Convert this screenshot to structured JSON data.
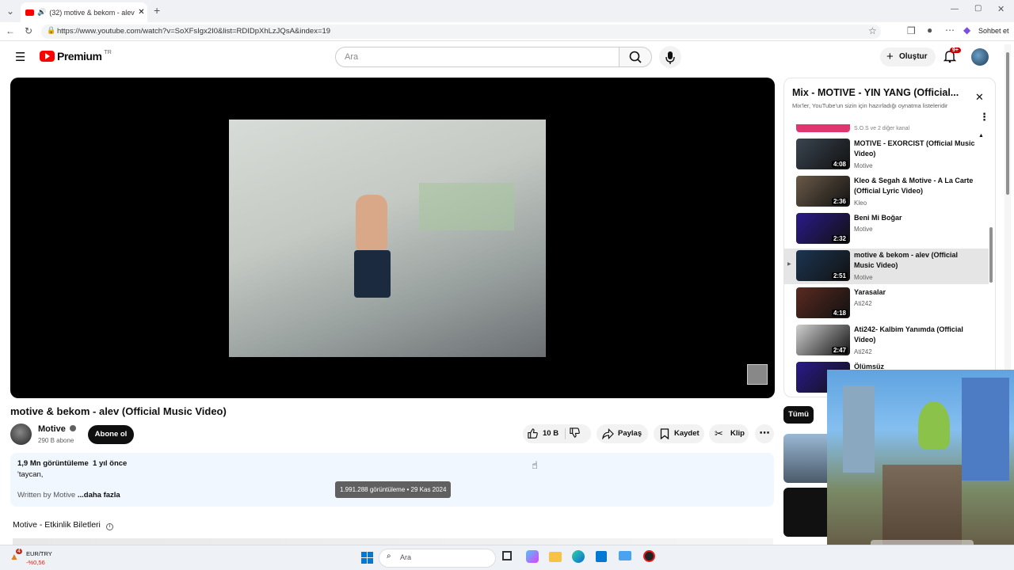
{
  "browser": {
    "tab_title": "(32) motive & bekom - alev (",
    "url": "https://www.youtube.com/watch?v=SoXFsIgx2I0&list=RDIDpXhLzJQsA&index=19",
    "chat_label": "Sohbet et"
  },
  "header": {
    "logo_text": "Premium",
    "logo_region": "TR",
    "search_placeholder": "Ara",
    "create_label": "Oluştur",
    "notification_count": "9+"
  },
  "video": {
    "title": "motive & bekom - alev (Official Music Video)",
    "channel_name": "Motive",
    "subscribers": "290 B abone",
    "subscribe_label": "Abone ol",
    "like_count": "10 B",
    "share_label": "Paylaş",
    "save_label": "Kaydet",
    "clip_label": "Klip"
  },
  "description": {
    "views": "1,9 Mn görüntüleme",
    "age": "1 yıl önce",
    "line1": "'taycan,",
    "line2": "Written by Motive",
    "more": "...daha fazla",
    "tooltip": "1.991.288 görüntüleme • 29 Kas 2024"
  },
  "events": {
    "title": "Motive - Etkinlik Biletleri"
  },
  "playlist": {
    "title": "Mix - MOTIVE - YIN YANG (Official...",
    "subtitle": "Mix'ler, YouTube'un sizin için hazırladığı oynatma listeleridir",
    "top_partial": "S.O.S ve 2 diğer kanal",
    "items": [
      {
        "title": "MOTIVE - EXORCIST (Official Music Video)",
        "channel": "Motive",
        "duration": "4:08",
        "color": "#3a4450"
      },
      {
        "title": "Kleo & Segah & Motive - A La Carte (Official Lyric Video)",
        "channel": "Kleo",
        "duration": "2:36",
        "color": "#6a5a48"
      },
      {
        "title": "Beni Mi Boğar",
        "channel": "Motive",
        "duration": "2:32",
        "color": "#2a1a8a"
      },
      {
        "title": "motive & bekom - alev (Official Music Video)",
        "channel": "Motive",
        "duration": "2:51",
        "color": "#1c3552"
      },
      {
        "title": "Yarasalar",
        "channel": "Ati242",
        "duration": "4:18",
        "color": "#5a2a20"
      },
      {
        "title": "Ati242- Kalbim Yanımda (Official Video)",
        "channel": "Ati242",
        "duration": "2:47",
        "color": "#d0d0d0"
      },
      {
        "title": "Ölümsüz",
        "channel": "",
        "duration": "",
        "color": "#2a1a8a"
      }
    ]
  },
  "chips": {
    "all": "Tümü"
  },
  "taskbar": {
    "currency": "EUR/TRY",
    "change": "-%0,56",
    "search_label": "Ara",
    "weather_badge": "4"
  }
}
